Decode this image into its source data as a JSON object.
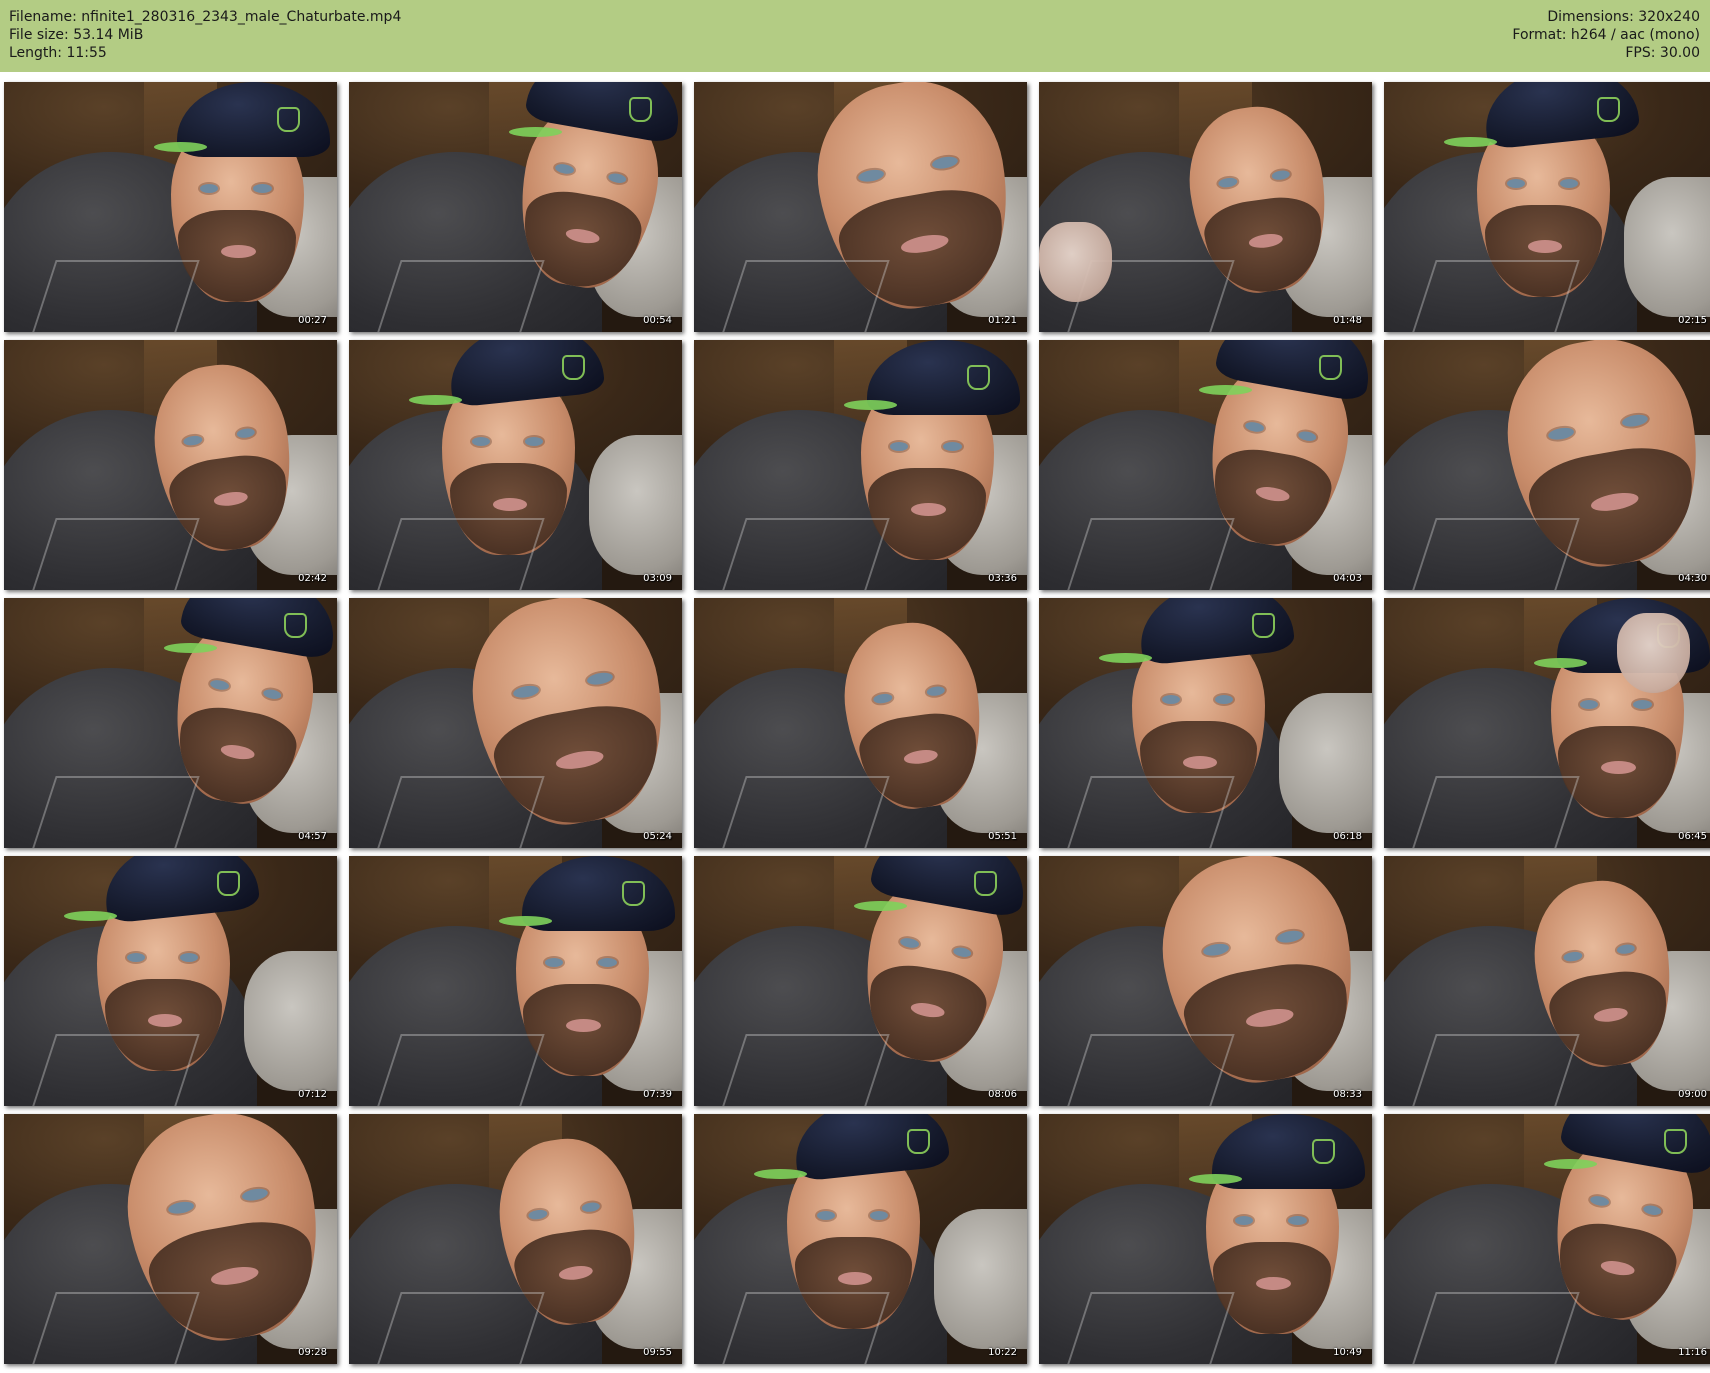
{
  "header": {
    "filename": "Filename: nfinite1_280316_2343_male_Chaturbate.mp4",
    "file_size": "File size: 53.14 MiB",
    "length": "Length: 11:55",
    "dimensions": "Dimensions: 320x240",
    "format": "Format: h264 / aac (mono)",
    "fps": "FPS: 30.00"
  },
  "colors": {
    "header_bg": "#b3cc84",
    "page_bg": "#ffffff",
    "timestamp_text": "#ffffff",
    "cap_logo": "#8ccf5a"
  },
  "thumbnails": [
    {
      "time": "00:27"
    },
    {
      "time": "00:54"
    },
    {
      "time": "01:21"
    },
    {
      "time": "01:48"
    },
    {
      "time": "02:15"
    },
    {
      "time": "02:42"
    },
    {
      "time": "03:09"
    },
    {
      "time": "03:36"
    },
    {
      "time": "04:03"
    },
    {
      "time": "04:30"
    },
    {
      "time": "04:57"
    },
    {
      "time": "05:24"
    },
    {
      "time": "05:51"
    },
    {
      "time": "06:18"
    },
    {
      "time": "06:45"
    },
    {
      "time": "07:12"
    },
    {
      "time": "07:39"
    },
    {
      "time": "08:06"
    },
    {
      "time": "08:33"
    },
    {
      "time": "09:00"
    },
    {
      "time": "09:28"
    },
    {
      "time": "09:55"
    },
    {
      "time": "10:22"
    },
    {
      "time": "10:49"
    },
    {
      "time": "11:16"
    }
  ]
}
